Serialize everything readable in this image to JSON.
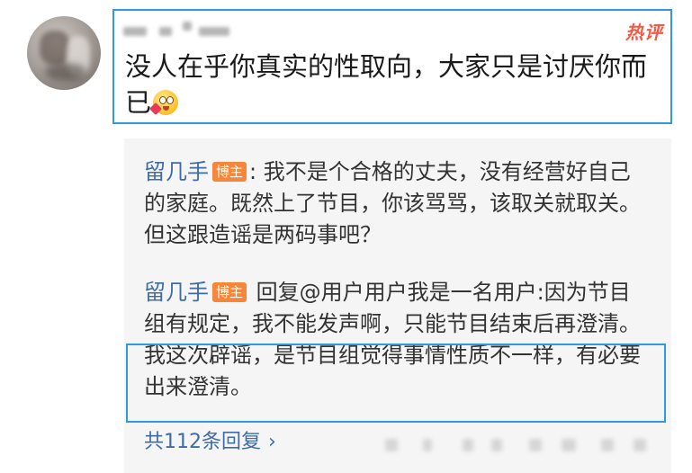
{
  "comment": {
    "hot_badge": "热评",
    "text": "没人在乎你真实的性取向，大家只是讨厌你而已",
    "emoji_icon": "heart-eyes-emoji-icon"
  },
  "replies": [
    {
      "author": "留几手",
      "badge": "博主",
      "text": ": 我不是个合格的丈夫，没有经营好自己的家庭。既然上了节目，你该骂骂，该取关就取关。但这跟造谣是两码事吧？"
    },
    {
      "author": "留几手",
      "badge": "博主",
      "text": " 回复@用户用户我是一名用户:因为节目组有规定，我不能发声啊，只能节目结束后再澄清。我这次辟谣，是节目组觉得事情性质不一样，有必要出来澄清。"
    }
  ],
  "more_replies": {
    "label": "共112条回复",
    "chevron": "›"
  },
  "colors": {
    "highlight_border": "#2f9ae0",
    "link_blue": "#3f6ca6",
    "hot_red": "#f05a45",
    "blogger_badge_orange": "#f6863a",
    "reply_bg": "#f5f5f5"
  }
}
